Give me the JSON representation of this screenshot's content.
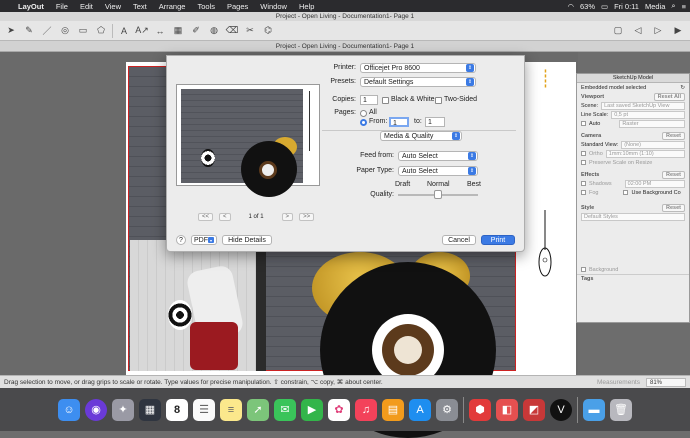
{
  "menubar": {
    "app": "LayOut",
    "items": [
      "File",
      "Edit",
      "View",
      "Text",
      "Arrange",
      "Tools",
      "Pages",
      "Window",
      "Help"
    ],
    "battery": "63%",
    "clock": "Fri 0:11",
    "user": "Media"
  },
  "window": {
    "title": "Project - Open Living - Documentation1- Page 1",
    "doc_title": "Project - Open Living - Documentation1- Page 1"
  },
  "toolbar": {
    "icons": [
      "arrow-icon",
      "pencil-icon",
      "line-icon",
      "circle-icon",
      "rectangle-icon",
      "polygon-icon",
      "text-icon",
      "label-icon",
      "dimension-icon",
      "table-icon",
      "sample-icon",
      "paint-icon",
      "eraser-icon",
      "split-icon",
      "join-icon"
    ]
  },
  "print_dialog": {
    "printer_label": "Printer:",
    "printer_value": "Officejet Pro 8600",
    "presets_label": "Presets:",
    "presets_value": "Default Settings",
    "copies_label": "Copies:",
    "copies_value": "1",
    "bw_label": "Black & White",
    "two_sided_label": "Two-Sided",
    "pages_label": "Pages:",
    "all_label": "All",
    "from_label": "From:",
    "from_value": "1",
    "to_label": "to:",
    "to_value": "1",
    "section_value": "Media & Quality",
    "feed_label": "Feed from:",
    "feed_value": "Auto Select",
    "paper_label": "Paper Type:",
    "paper_value": "Auto Select",
    "quality_label": "Quality:",
    "quality_draft": "Draft",
    "quality_normal": "Normal",
    "quality_best": "Best",
    "quality_level": "normal",
    "page_indicator": "1 of 1",
    "help": "?",
    "pdf": "PDF",
    "hide_details": "Hide Details",
    "cancel": "Cancel",
    "print": "Print"
  },
  "palette": {
    "title": "SketchUp Model",
    "embedded": "Embedded model selected",
    "viewport": "Viewport",
    "reset": "Reset All",
    "scene_label": "Scene:",
    "scene_value": "Last saved SketchUp View",
    "line_scale_label": "Line Scale:",
    "line_scale_value": "0,5 pt",
    "auto_label": "Auto",
    "raster_value": "Raster",
    "camera": "Camera",
    "camera_reset": "Reset",
    "standard_view_label": "Standard View:",
    "standard_view_value": "(None)",
    "ortho_label": "Ortho",
    "ortho_value": "1mm:10mm (1:10)",
    "preserve_label": "Preserve Scale on Resize",
    "effects": "Effects",
    "effects_reset": "Reset",
    "shadows_label": "Shadows",
    "shadows_time": "02:00 PM",
    "fog_label": "Fog",
    "bg_label": "Use Background Co",
    "style": "Style",
    "style_reset": "Reset",
    "style_value": "Default Styles",
    "background_label": "Background",
    "tags": "Tags"
  },
  "status": {
    "hint": "Drag selection to move, or drag grips to scale or rotate. Type values for precise manipulation. ⇧ constrain, ⌥ copy, ⌘ about center.",
    "measurements_label": "Measurements",
    "zoom": "81%"
  },
  "dock": {
    "apps": [
      "finder-icon",
      "siri-icon",
      "launchpad-icon",
      "mission-control-icon",
      "calendar-icon",
      "reminders-icon",
      "notes-icon",
      "maps-icon",
      "messages-icon",
      "facetime-icon",
      "photos-icon",
      "music-icon",
      "books-icon",
      "appstore-icon",
      "preferences-icon",
      "sketchup-icon",
      "layout-icon",
      "styles-icon",
      "vectorworks-icon",
      "folder-icon",
      "trash-icon"
    ],
    "calendar_day": "8"
  },
  "colors": {
    "accent": "#3b7ae4",
    "menubar": "#2b2b2e"
  }
}
